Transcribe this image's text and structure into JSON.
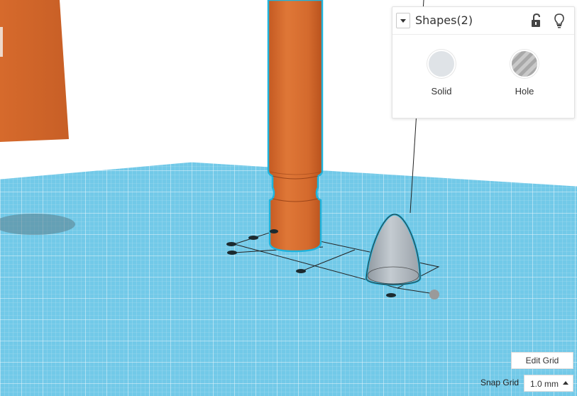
{
  "shapes_panel": {
    "title": "Shapes(2)",
    "options": [
      {
        "label": "Solid"
      },
      {
        "label": "Hole"
      }
    ]
  },
  "grid_controls": {
    "edit_grid_label": "Edit Grid",
    "snap_grid_label": "Snap Grid",
    "snap_value": "1.0 mm"
  },
  "icons": {
    "collapse": "chevron-down-icon",
    "lock": "unlock-icon",
    "bulb": "lightbulb-icon"
  },
  "colors": {
    "workplane": "#6fcbeb",
    "shape_fill": "#d2692d",
    "selection_outline": "#1fb4dd",
    "hole_fill": "#b9c0c6"
  }
}
